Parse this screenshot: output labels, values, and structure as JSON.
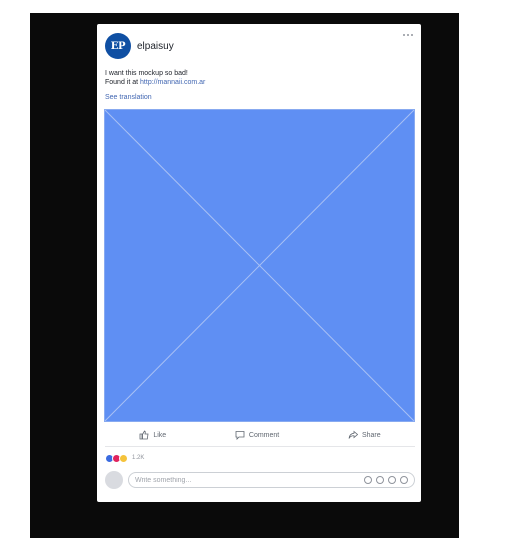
{
  "post": {
    "page_name": "elpaisuy",
    "logo_text": "EP",
    "text_line1": "I want this mockup so bad!",
    "text_line2_prefix": "Found it at ",
    "text_link": "http://mannaii.com.ar",
    "see_translation": "See translation"
  },
  "actions": {
    "like": "Like",
    "comment": "Comment",
    "share": "Share"
  },
  "reactions": {
    "count": "1.2K"
  },
  "comment_box": {
    "placeholder": "Write something..."
  },
  "colors": {
    "media_fill": "#5f8ff3",
    "brand_blue": "#4267b2",
    "logo_blue": "#0f4fa3"
  }
}
